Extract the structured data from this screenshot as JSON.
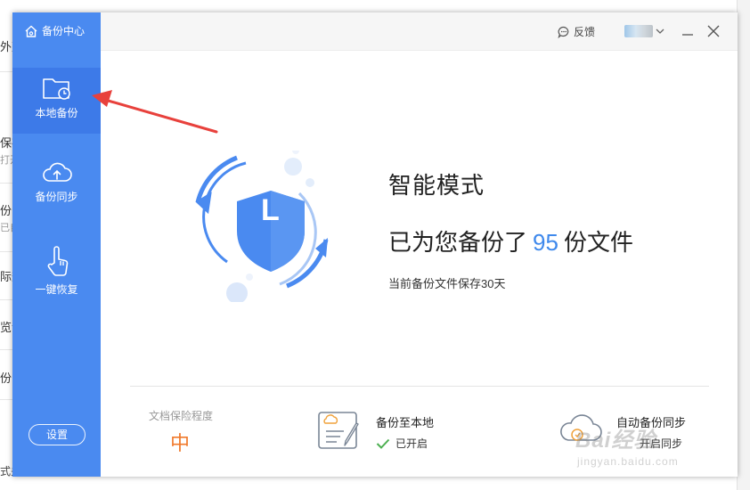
{
  "background_app": {
    "rows": [
      {
        "text": "外双",
        "sub": ""
      },
      {
        "text": "保存",
        "sub": "打开"
      },
      {
        "text": "份同",
        "sub": "已自"
      },
      {
        "text": "际效",
        "sub": ""
      },
      {
        "text": "览试",
        "sub": ""
      },
      {
        "text": "份中",
        "sub": ""
      }
    ],
    "bottom_text": "式关联..."
  },
  "brand": {
    "label": "备份中心",
    "icon": "home-icon"
  },
  "sidebar": {
    "items": [
      {
        "label": "本地备份",
        "icon": "folder-clock-icon",
        "active": true
      },
      {
        "label": "备份同步",
        "icon": "cloud-upload-icon",
        "active": false
      },
      {
        "label": "一键恢复",
        "icon": "hand-tap-icon",
        "active": false
      }
    ],
    "settings_label": "设置"
  },
  "titlebar": {
    "feedback_label": "反馈",
    "feedback_icon": "chat-bubble-icon"
  },
  "main": {
    "mode_title": "智能模式",
    "summary_prefix": "已为您备份了",
    "file_count": "95",
    "summary_suffix": "份文件",
    "retention": "当前备份文件保存30天",
    "shield_letter": "L"
  },
  "stats": {
    "protection_label": "文档保险程度",
    "protection_value": "中"
  },
  "local_backup": {
    "title": "备份至本地",
    "status": "已开启"
  },
  "auto_sync": {
    "title": "自动备份同步",
    "status": "开启同步"
  },
  "watermark": {
    "brand": "Bai经验",
    "url": "jingyan.baidu.com"
  },
  "colors": {
    "sidebar": "#4a8af0",
    "accent": "#3f89ec",
    "orange": "#f07a2c",
    "check": "#4caf50",
    "arrow": "#e8413c"
  }
}
